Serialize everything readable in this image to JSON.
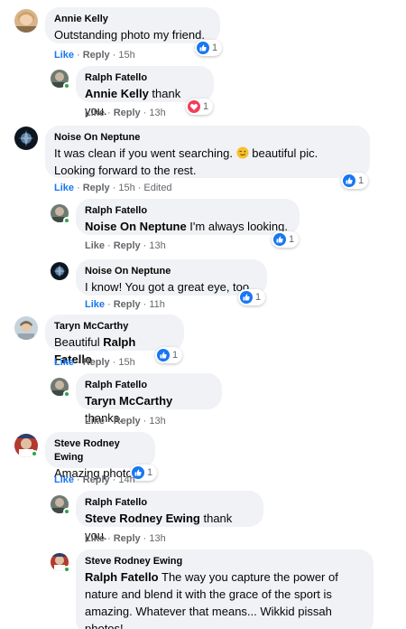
{
  "actions": {
    "like": "Like",
    "reply": "Reply",
    "edited": "Edited"
  },
  "comments": [
    {
      "author": "Annie Kelly",
      "text": "Outstanding photo my friend.",
      "time": "15h",
      "reaction_count": "1",
      "reaction": "like"
    },
    {
      "author": "Ralph Fatello",
      "mention": "Annie Kelly",
      "text": " thank you.",
      "time": "13h",
      "reaction_count": "1",
      "reaction": "love"
    },
    {
      "author": "Noise On Neptune",
      "text": "It was clean if you went searching.",
      "emoji": "winking-face",
      "text2": " beautiful pic. Looking forward to the rest.",
      "time": "15h",
      "reaction_count": "1",
      "reaction": "like"
    },
    {
      "author": "Ralph Fatello",
      "mention": "Noise On Neptune",
      "text": " I'm always looking.",
      "time": "13h",
      "reaction_count": "1",
      "reaction": "like"
    },
    {
      "author": "Noise On Neptune",
      "text": "I know! You got a great eye, too.",
      "time": "11h",
      "reaction_count": "1",
      "reaction": "like"
    },
    {
      "author": "Taryn McCarthy",
      "text": "Beautiful ",
      "mention": "Ralph Fatello",
      "time": "15h",
      "reaction_count": "1",
      "reaction": "like"
    },
    {
      "author": "Ralph Fatello",
      "mention": "Taryn McCarthy",
      "text": " thanks.",
      "time": "13h"
    },
    {
      "author": "Steve Rodney Ewing",
      "text": "Amazing photo!",
      "time": "14h",
      "reaction_count": "1",
      "reaction": "like"
    },
    {
      "author": "Ralph Fatello",
      "mention": "Steve Rodney Ewing",
      "text": " thank you.",
      "time": "13h"
    },
    {
      "author": "Steve Rodney Ewing",
      "mention": "Ralph Fatello",
      "text": " The way you capture the power of nature and blend it with the grace of the sport is amazing. Whatever that means... Wikkid pissah photos!"
    }
  ],
  "colors": {
    "like_blue": "#1877f2",
    "love_red": "#f33e58",
    "bubble": "#f0f2f5",
    "online": "#31a24c",
    "meta": "#65676b"
  }
}
